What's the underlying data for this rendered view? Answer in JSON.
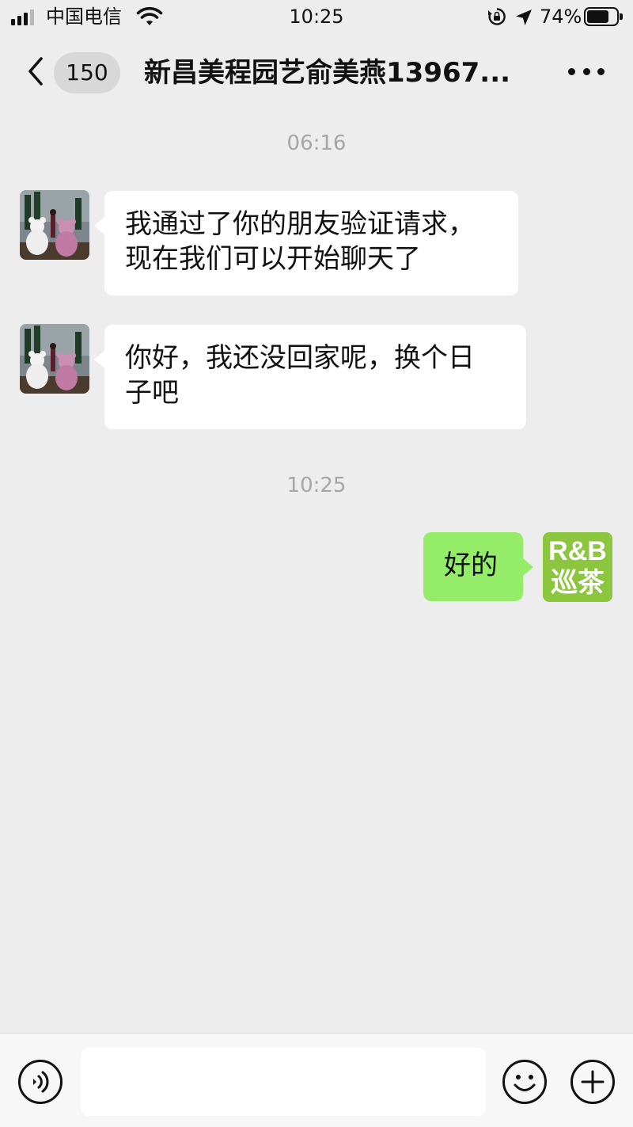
{
  "status_bar": {
    "carrier": "中国电信",
    "time": "10:25",
    "battery_percent": "74%",
    "battery_level": 0.74,
    "icons": [
      "signal-icon",
      "wifi-icon",
      "rotation-lock-icon",
      "location-arrow-icon",
      "battery-icon"
    ]
  },
  "nav": {
    "unread_count": "150",
    "title": "新昌美程园艺俞美燕13967...",
    "icons": [
      "back-chevron-icon",
      "more-dots-icon"
    ]
  },
  "messages": [
    {
      "type": "timestamp",
      "text": "06:16"
    },
    {
      "type": "incoming",
      "text": "我通过了你的朋友验证请求，\n现在我们可以开始聊天了",
      "avatar": "teddy-bear-photo-avatar"
    },
    {
      "type": "incoming",
      "text": "你好，我还没回家呢，换个日\n子吧",
      "avatar": "teddy-bear-photo-avatar"
    },
    {
      "type": "timestamp",
      "text": "10:25"
    },
    {
      "type": "outgoing",
      "text": "好的",
      "avatar": "rb-tea-logo-avatar"
    }
  ],
  "own_avatar": {
    "line1": "R&B",
    "line2": "巡茶"
  },
  "input_bar": {
    "placeholder": "",
    "icons": [
      "voice-icon",
      "emoji-icon",
      "plus-icon"
    ]
  },
  "colors": {
    "background": "#ededed",
    "outgoing_bubble": "#95ec69",
    "incoming_bubble": "#ffffff",
    "timestamp_text": "#a6a6a6",
    "logo_green": "#8cc63f"
  }
}
